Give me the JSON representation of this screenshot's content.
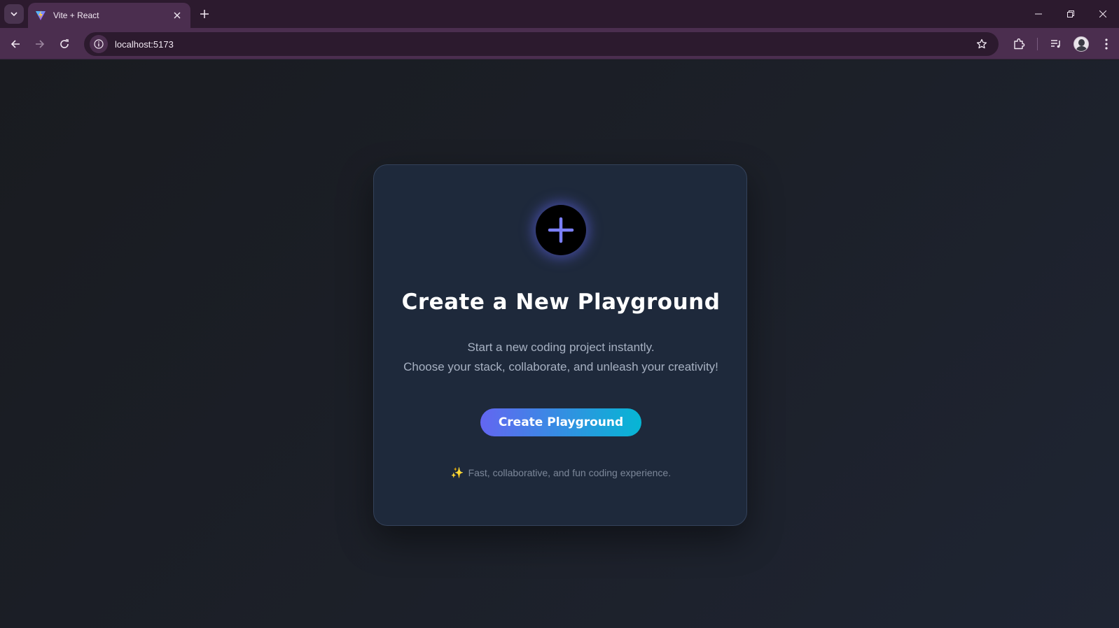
{
  "browser": {
    "tab": {
      "title": "Vite + React"
    },
    "address_bar": {
      "url": "localhost:5173"
    }
  },
  "page": {
    "title": "Create a New Playground",
    "description_line1": "Start a new coding project instantly.",
    "description_line2": "Choose your stack, collaborate, and unleash your creativity!",
    "cta_label": "Create Playground",
    "footer_icon": "✨",
    "footer_text": "Fast, collaborative, and fun coding experience."
  },
  "colors": {
    "accent_start": "#6366f1",
    "accent_end": "#06b6d4",
    "card_bg": "#1e293b",
    "page_bg": "#1c2029"
  },
  "icons": [
    "tab-list-icon",
    "vite-favicon",
    "close-icon",
    "plus-icon",
    "minimize-icon",
    "restore-icon",
    "back-icon",
    "forward-icon",
    "reload-icon",
    "site-info-icon",
    "star-icon",
    "extensions-icon",
    "media-control-icon",
    "kebab-menu-icon"
  ]
}
